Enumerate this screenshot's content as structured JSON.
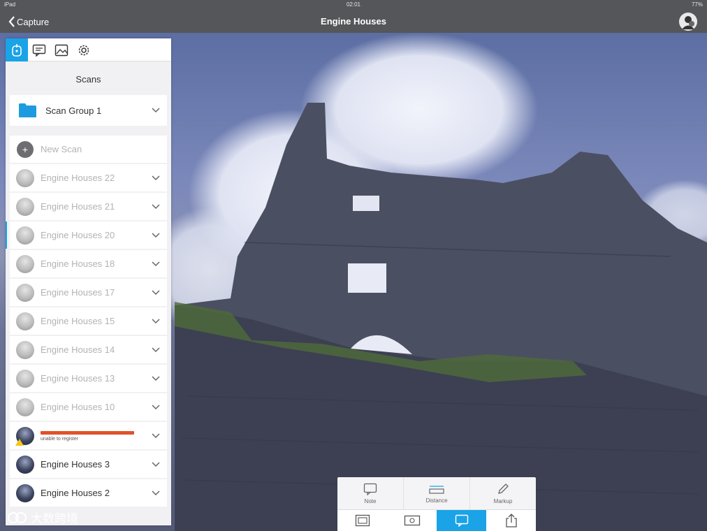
{
  "status_bar": {
    "device": "iPad",
    "time": "02:01",
    "battery": "77%"
  },
  "nav": {
    "back_label": "Capture",
    "title": "Engine Houses"
  },
  "panel": {
    "title": "Scans",
    "group": {
      "label": "Scan Group 1"
    },
    "new_scan_label": "New Scan",
    "scans": [
      {
        "label": "Engine Houses 22",
        "thumb": "grey",
        "state": "normal"
      },
      {
        "label": "Engine Houses 21",
        "thumb": "grey",
        "state": "normal"
      },
      {
        "label": "Engine Houses 20",
        "thumb": "grey",
        "state": "selected"
      },
      {
        "label": "Engine Houses 18",
        "thumb": "grey",
        "state": "normal"
      },
      {
        "label": "Engine Houses 17",
        "thumb": "grey",
        "state": "normal"
      },
      {
        "label": "Engine Houses 15",
        "thumb": "grey",
        "state": "normal"
      },
      {
        "label": "Engine Houses 14",
        "thumb": "grey",
        "state": "normal"
      },
      {
        "label": "Engine Houses 13",
        "thumb": "grey",
        "state": "normal"
      },
      {
        "label": "Engine Houses 10",
        "thumb": "grey",
        "state": "normal"
      }
    ],
    "error_scan": {
      "status_text": "unable to register"
    },
    "registered_scans": [
      {
        "label": "Engine Houses 3"
      },
      {
        "label": "Engine Houses 2"
      }
    ]
  },
  "tools": {
    "note_label": "Note",
    "distance_label": "Distance",
    "markup_label": "Markup"
  },
  "watermark": {
    "text": "大数跨境"
  },
  "colors": {
    "accent": "#1aa3e6",
    "error": "#e2502a",
    "warning": "#f6c51b",
    "bar": "#555659"
  }
}
